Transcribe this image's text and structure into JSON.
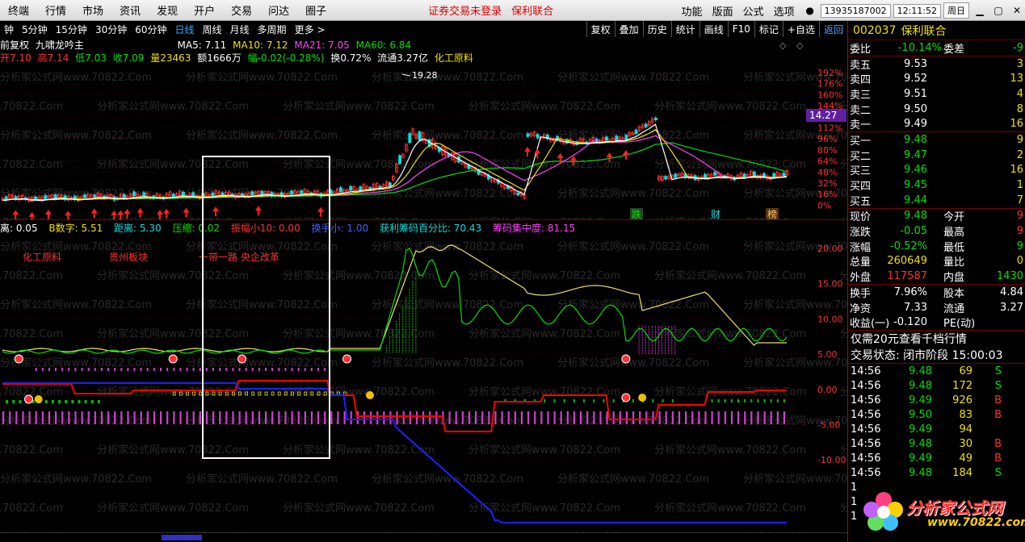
{
  "menu": {
    "items": [
      "终端",
      "行情",
      "市场",
      "资讯",
      "发现",
      "开户",
      "交易",
      "问达",
      "圈子"
    ],
    "warning": "证券交易未登录",
    "stock_name": "保利联合",
    "right_items": [
      "功能",
      "版面",
      "公式",
      "选项"
    ],
    "phone": "13935187002",
    "time": "12:11:52",
    "weekday": "周日"
  },
  "periods": [
    "钟",
    "5分钟",
    "15分钟",
    "30分钟",
    "60分钟",
    "日线",
    "周线",
    "月线",
    "多周期",
    "更多"
  ],
  "active_period": "日线",
  "toolbar_buttons": [
    "复权",
    "叠加",
    "历史",
    "统计",
    "画线",
    "F10",
    "标记",
    "+自选",
    "返回"
  ],
  "info_line1": {
    "adjust": "前复权",
    "formula": "九啸龙吟主",
    "ma5": "MA5: 7.11",
    "ma10": "MA10: 7.12",
    "ma21": "MA21: 7.05",
    "ma60": "MA60: 6.84"
  },
  "info_line2": {
    "open": "开7.10",
    "high": "高7.14",
    "low": "低7.03",
    "close": "收7.09",
    "vol": "量23463",
    "amount": "额1666万",
    "amp": "幅-0.02(-0.28%)",
    "turnover": "换0.72%",
    "float": "流通3.27亿",
    "sector": "化工原料"
  },
  "main_axis": {
    "labels": [
      "192%",
      "176%",
      "160%",
      "144%",
      "128%",
      "112%",
      "96%",
      "80%",
      "64%",
      "48%",
      "32%",
      "16%",
      "0%"
    ],
    "current_price": "14.27",
    "peak_label": "19.28"
  },
  "main_events": [
    "跌",
    "财",
    "榜"
  ],
  "indicator": {
    "a": "离: 0.05",
    "b": "B数字: 5.51",
    "c": "距离: 5.30",
    "d": "压缩: 0.02",
    "e": "振幅小10: 0.00",
    "f": "换手小: 1.00",
    "g": "获利筹码百分比: 70.43",
    "h": "筹码集中度: 81.15"
  },
  "sub_notes": [
    "化工原料",
    "贵州板块",
    "一带一路 央企改革"
  ],
  "sub_axis": [
    "20.00",
    "15.00",
    "10.00",
    "5.00",
    "0.00",
    "-5.00",
    "-10.00"
  ],
  "watermark": "分析家公式网www.70822.Com",
  "right_panel": {
    "code": "002037",
    "name": "保利联合",
    "weibi": {
      "label": "委比",
      "value": "-10.14%",
      "label2": "委差",
      "value2": "-9"
    },
    "asks": [
      {
        "label": "卖五",
        "price": "9.53",
        "vol": "3"
      },
      {
        "label": "卖四",
        "price": "9.52",
        "vol": "13"
      },
      {
        "label": "卖三",
        "price": "9.51",
        "vol": "4"
      },
      {
        "label": "卖二",
        "price": "9.50",
        "vol": "8"
      },
      {
        "label": "卖一",
        "price": "9.49",
        "vol": "16"
      }
    ],
    "bids": [
      {
        "label": "买一",
        "price": "9.48",
        "vol": "9"
      },
      {
        "label": "买二",
        "price": "9.47",
        "vol": "2"
      },
      {
        "label": "买三",
        "price": "9.46",
        "vol": "16"
      },
      {
        "label": "买四",
        "price": "9.45",
        "vol": "1"
      },
      {
        "label": "买五",
        "price": "9.44",
        "vol": "7"
      }
    ],
    "stats": [
      {
        "l": "现价",
        "v": "9.48",
        "vc": "g",
        "l2": "今开",
        "v2": "9",
        "v2c": "r"
      },
      {
        "l": "涨跌",
        "v": "-0.05",
        "vc": "g",
        "l2": "最高",
        "v2": "9",
        "v2c": "r"
      },
      {
        "l": "涨幅",
        "v": "-0.52%",
        "vc": "g",
        "l2": "最低",
        "v2": "9",
        "v2c": "g"
      },
      {
        "l": "总量",
        "v": "260649",
        "vc": "y",
        "l2": "量比",
        "v2": "0",
        "v2c": "y"
      },
      {
        "l": "外盘",
        "v": "117587",
        "vc": "r",
        "l2": "内盘",
        "v2": "1430",
        "v2c": "g"
      }
    ],
    "stats2": [
      {
        "l": "换手",
        "v": "7.96%",
        "l2": "股本",
        "v2": "4.84"
      },
      {
        "l": "净资",
        "v": "7.33",
        "l2": "流通",
        "v2": "3.27"
      },
      {
        "l": "收益(一)",
        "v": "-0.120",
        "l2": "PE(动)",
        "v2": ""
      }
    ],
    "notes": [
      "仅需20元查看千档行情",
      "交易状态: 闭市阶段 15:00:03"
    ],
    "ticks": [
      {
        "t": "14:56",
        "p": "9.48",
        "v": "69",
        "d": "S"
      },
      {
        "t": "14:56",
        "p": "9.48",
        "v": "172",
        "d": "S"
      },
      {
        "t": "14:56",
        "p": "9.49",
        "v": "926",
        "d": "B"
      },
      {
        "t": "14:56",
        "p": "9.50",
        "v": "83",
        "d": "B"
      },
      {
        "t": "14:56",
        "p": "9.49",
        "v": "94",
        "d": ""
      },
      {
        "t": "14:56",
        "p": "9.48",
        "v": "30",
        "d": "B"
      },
      {
        "t": "14:56",
        "p": "9.49",
        "v": "49",
        "d": "B"
      },
      {
        "t": "14:56",
        "p": "9.48",
        "v": "184",
        "d": "S"
      },
      {
        "t": "1",
        "p": "",
        "v": "",
        "d": ""
      },
      {
        "t": "1",
        "p": "",
        "v": "",
        "d": ""
      },
      {
        "t": "1",
        "p": "",
        "v": "",
        "d": ""
      }
    ]
  },
  "logo": {
    "text1": "分析家公式网",
    "text2": "www.70822.com"
  },
  "colors": {
    "up": "#ff3030",
    "down": "#00e0e0",
    "ma5": "#ffffff",
    "ma10": "#f0e000",
    "ma21": "#ff40ff",
    "ma60": "#00e000"
  }
}
